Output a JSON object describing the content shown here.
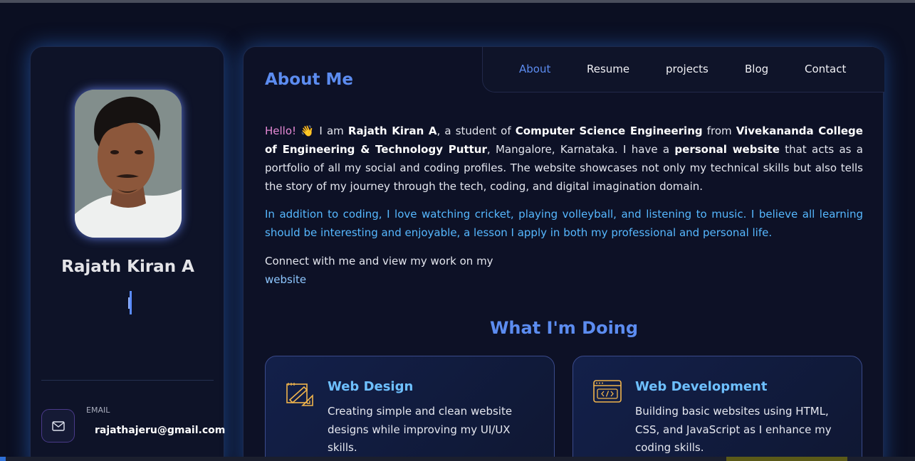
{
  "profile": {
    "name": "Rajath Kiran A",
    "email_label": "EMAIL",
    "email": "rajathajeru@gmail.com"
  },
  "nav": {
    "items": [
      "About",
      "Resume",
      "projects",
      "Blog",
      "Contact"
    ],
    "active": "About"
  },
  "about": {
    "title": "About Me",
    "p1": {
      "hello": "Hello!",
      "emoji": "👋",
      "t1": " I am ",
      "name": "Rajath Kiran A",
      "t2": ", a student of ",
      "course": "Computer Science Engineering",
      "t3": " from ",
      "college": "Vivekananda College of Engineering & Technology Puttur",
      "t4": ", Mangalore, Karnataka. I have a ",
      "personal": "personal website",
      "t5": " that acts as a portfolio of all my social and coding profiles. The website showcases not only my technical skills but also tells the story of my journey through the tech, coding, and digital imagination domain."
    },
    "p2": "In addition to coding, I love watching cricket, playing volleyball, and listening to music. I believe all learning should be interesting and enjoyable, a lesson I apply in both my professional and personal life.",
    "p3": "Connect with me and view my work on my",
    "website_link": "website"
  },
  "doing": {
    "title": "What I'm Doing",
    "cards": [
      {
        "title": "Web Design",
        "text": "Creating simple and clean website designs while improving my UI/UX skills.",
        "icon": "design-pen-icon"
      },
      {
        "title": "Web Development",
        "text": "Building basic websites using HTML, CSS, and JavaScript as I enhance my coding skills.",
        "icon": "code-window-icon"
      }
    ]
  },
  "colors": {
    "accent": "#5c8cf0",
    "highlight": "#56b8ff",
    "hello": "#e68ad6",
    "icon": "#f0b44c"
  }
}
